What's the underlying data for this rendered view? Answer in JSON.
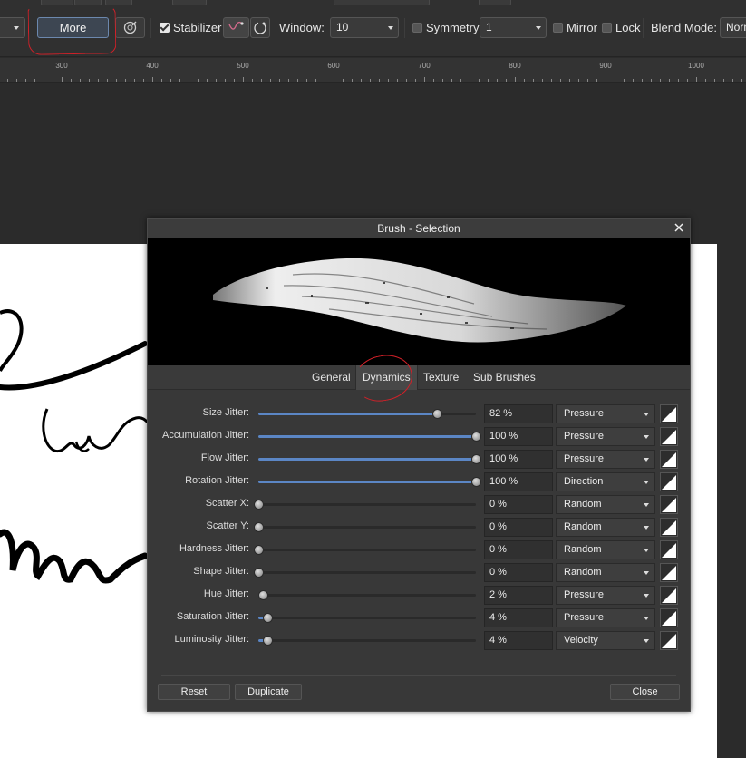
{
  "toolbar": {
    "more_label": "More",
    "stabilizer_label": "Stabilizer",
    "stabilizer_checked": true,
    "window_label": "Window:",
    "window_value": "10",
    "symmetry_label": "Symmetry",
    "symmetry_checked": false,
    "symmetry_value": "1",
    "mirror_label": "Mirror",
    "mirror_checked": false,
    "lock_label": "Lock",
    "lock_checked": false,
    "blend_mode_label": "Blend Mode:",
    "blend_mode_value": "Norm"
  },
  "ruler": {
    "labels": [
      "300",
      "400",
      "500",
      "600",
      "700",
      "800",
      "900",
      "1000"
    ]
  },
  "dialog": {
    "title": "Brush - Selection",
    "tabs": [
      {
        "label": "General",
        "active": false
      },
      {
        "label": "Dynamics",
        "active": true
      },
      {
        "label": "Texture",
        "active": false
      },
      {
        "label": "Sub Brushes",
        "active": false
      }
    ],
    "rows": [
      {
        "label": "Size Jitter:",
        "value": "82 %",
        "level": 0.82,
        "mode": "Pressure"
      },
      {
        "label": "Accumulation Jitter:",
        "value": "100 %",
        "level": 1.0,
        "mode": "Pressure"
      },
      {
        "label": "Flow Jitter:",
        "value": "100 %",
        "level": 1.0,
        "mode": "Pressure"
      },
      {
        "label": "Rotation Jitter:",
        "value": "100 %",
        "level": 1.0,
        "mode": "Direction"
      },
      {
        "label": "Scatter X:",
        "value": "0 %",
        "level": 0.0,
        "mode": "Random"
      },
      {
        "label": "Scatter Y:",
        "value": "0 %",
        "level": 0.0,
        "mode": "Random"
      },
      {
        "label": "Hardness Jitter:",
        "value": "0 %",
        "level": 0.0,
        "mode": "Random"
      },
      {
        "label": "Shape Jitter:",
        "value": "0 %",
        "level": 0.0,
        "mode": "Random"
      },
      {
        "label": "Hue Jitter:",
        "value": "2 %",
        "level": 0.02,
        "mode": "Pressure"
      },
      {
        "label": "Saturation Jitter:",
        "value": "4 %",
        "level": 0.04,
        "mode": "Pressure"
      },
      {
        "label": "Luminosity Jitter:",
        "value": "4 %",
        "level": 0.04,
        "mode": "Velocity"
      }
    ],
    "reset_label": "Reset",
    "duplicate_label": "Duplicate",
    "close_label": "Close"
  },
  "colors": {
    "accent": "#5b86c5",
    "annotation": "#d32028"
  },
  "icons": {
    "close": "close-icon",
    "stroke_preview": "brush-stroke-preview",
    "curve": "pressure-curve-icon"
  }
}
